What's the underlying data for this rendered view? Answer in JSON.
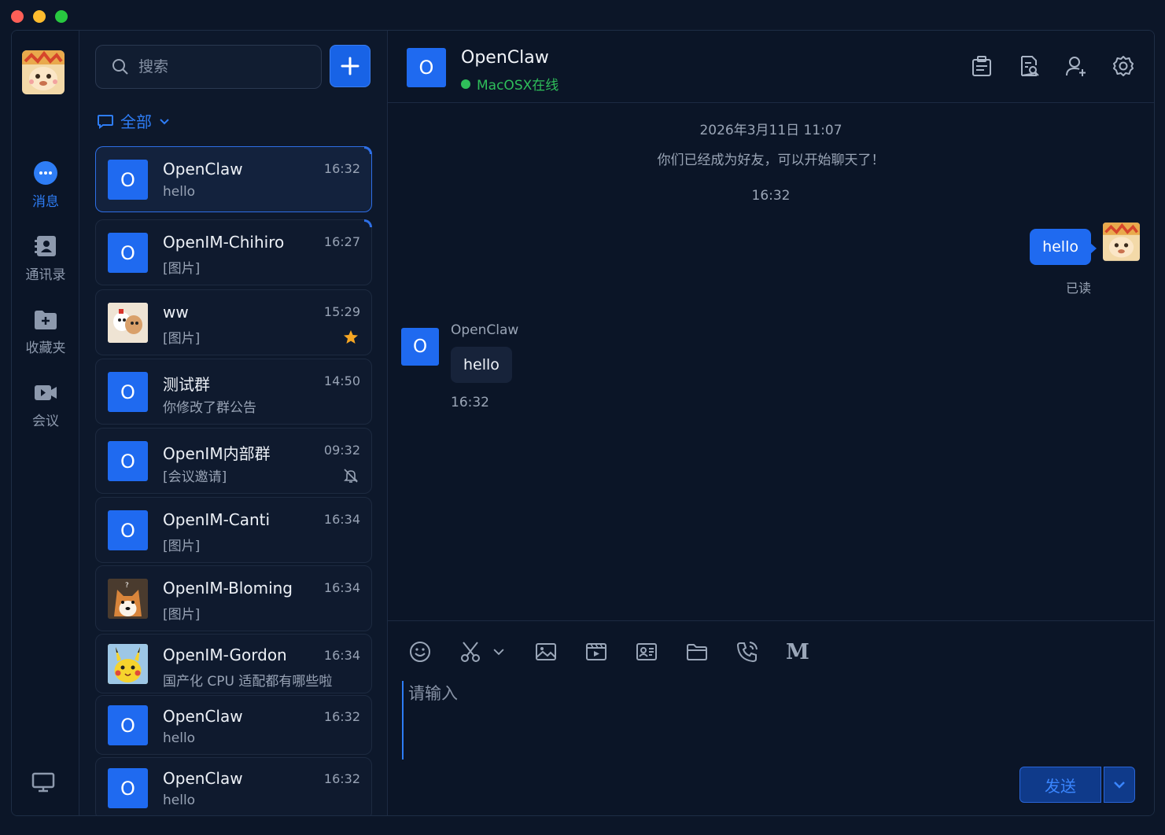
{
  "nav": {
    "items": [
      {
        "label": "消息",
        "icon": "chat-bubble-icon",
        "active": true
      },
      {
        "label": "通讯录",
        "icon": "contacts-icon",
        "active": false
      },
      {
        "label": "收藏夹",
        "icon": "favorites-folder-icon",
        "active": false
      },
      {
        "label": "会议",
        "icon": "video-camera-icon",
        "active": false
      }
    ]
  },
  "search": {
    "placeholder": "搜索"
  },
  "filter": {
    "label": "全部"
  },
  "conversations": [
    {
      "name": "OpenClaw",
      "preview": "hello",
      "time": "16:32",
      "initial": "O"
    },
    {
      "name": "OpenIM-Chihiro",
      "preview": "[图片]",
      "time": "16:27",
      "initial": "O"
    },
    {
      "name": "ww",
      "preview": "[图片]",
      "time": "15:29",
      "initial": ""
    },
    {
      "name": "测试群",
      "preview": "你修改了群公告",
      "time": "14:50",
      "initial": "O"
    },
    {
      "name": "OpenIM内部群",
      "preview": "[会议邀请]",
      "time": "09:32",
      "initial": "O"
    },
    {
      "name": "OpenIM-Canti",
      "preview": "[图片]",
      "time": "16:34",
      "initial": "O"
    },
    {
      "name": "OpenIM-Bloming",
      "preview": "[图片]",
      "time": "16:34",
      "initial": ""
    },
    {
      "name": "OpenIM-Gordon",
      "preview": "国产化 CPU 适配都有哪些啦",
      "time": "16:34",
      "initial": ""
    },
    {
      "name": "OpenClaw",
      "preview": "hello",
      "time": "16:32",
      "initial": "O"
    },
    {
      "name": "OpenClaw",
      "preview": "hello",
      "time": "16:32",
      "initial": "O"
    }
  ],
  "chat": {
    "title": "OpenClaw",
    "initial": "O",
    "status": "MacOSX在线",
    "date_stamp": "2026年3月11日 11:07",
    "friend_notice": "你们已经成为好友，可以开始聊天了！",
    "time_stamp": "16:32",
    "my_message": "hello",
    "read_label": "已读",
    "peer_name": "OpenClaw",
    "peer_message": "hello",
    "peer_time": "16:32"
  },
  "composer": {
    "placeholder": "请输入",
    "send_label": "发送",
    "markdown_glyph": "M"
  },
  "colors": {
    "accent": "#1f6af0",
    "online": "#2fbf5a",
    "favorite_star": "#f5a623"
  }
}
